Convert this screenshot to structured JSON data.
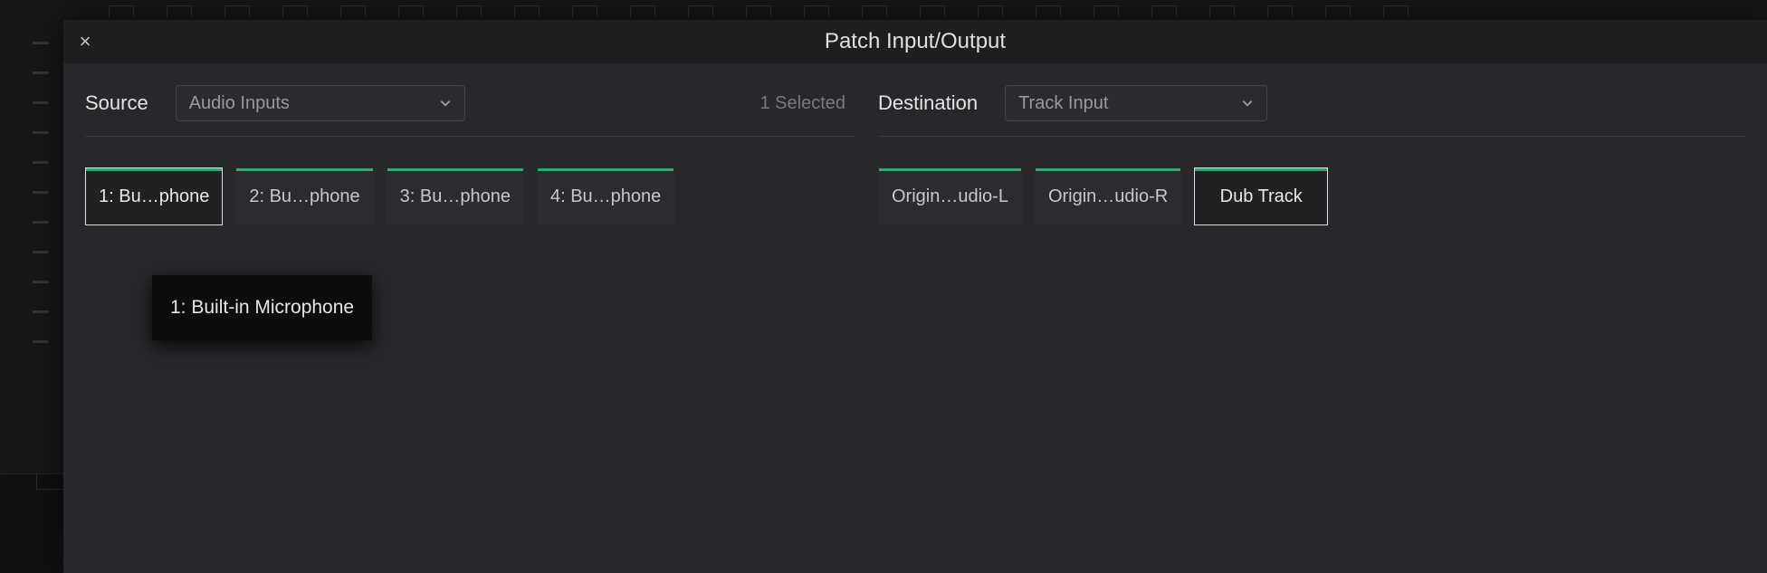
{
  "modal": {
    "title": "Patch Input/Output",
    "close_icon": "×"
  },
  "source": {
    "label": "Source",
    "dropdown": {
      "value": "Audio Inputs"
    },
    "selected_text": "1 Selected",
    "cards": [
      {
        "label": "1: Bu…phone",
        "selected": true
      },
      {
        "label": "2: Bu…phone",
        "selected": false
      },
      {
        "label": "3: Bu…phone",
        "selected": false
      },
      {
        "label": "4: Bu…phone",
        "selected": false
      }
    ]
  },
  "destination": {
    "label": "Destination",
    "dropdown": {
      "value": "Track Input"
    },
    "cards": [
      {
        "label": "Origin…udio-L",
        "selected": false
      },
      {
        "label": "Origin…udio-R",
        "selected": false
      },
      {
        "label": "Dub Track",
        "selected": true
      }
    ]
  },
  "tooltip": {
    "text": "1: Built-in Microphone"
  }
}
